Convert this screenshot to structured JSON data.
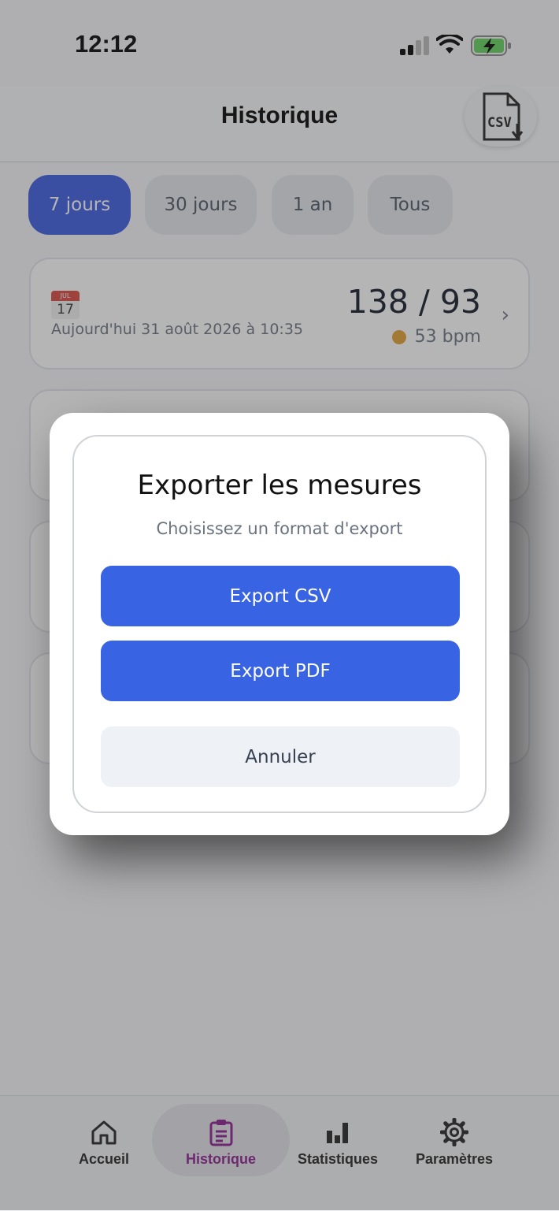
{
  "status_bar": {
    "time": "12:12"
  },
  "header": {
    "title": "Historique",
    "export_icon_text": "CSV"
  },
  "filters": [
    {
      "label": "7 jours",
      "active": true
    },
    {
      "label": "30 jours",
      "active": false
    },
    {
      "label": "1 an",
      "active": false
    },
    {
      "label": "Tous",
      "active": false
    }
  ],
  "measurements": [
    {
      "calendar_month": "JUL",
      "calendar_day": "17",
      "date": "Aujourd'hui 31 août 2026 à 10:35",
      "bp": "138 / 93",
      "pulse": "53 bpm",
      "pulse_color": "#e0a032"
    }
  ],
  "modal": {
    "title": "Exporter les mesures",
    "subtitle": "Choisissez un format d'export",
    "buttons": {
      "csv": "Export CSV",
      "pdf": "Export PDF",
      "cancel": "Annuler"
    }
  },
  "tabs": [
    {
      "label": "Accueil",
      "icon": "home-icon",
      "active": false
    },
    {
      "label": "Historique",
      "icon": "clipboard-icon",
      "active": true
    },
    {
      "label": "Statistiques",
      "icon": "bar-chart-icon",
      "active": false
    },
    {
      "label": "Paramètres",
      "icon": "gear-icon",
      "active": false
    }
  ],
  "colors": {
    "accent": "#3a5be0",
    "active_tab": "#8b1e8f"
  }
}
